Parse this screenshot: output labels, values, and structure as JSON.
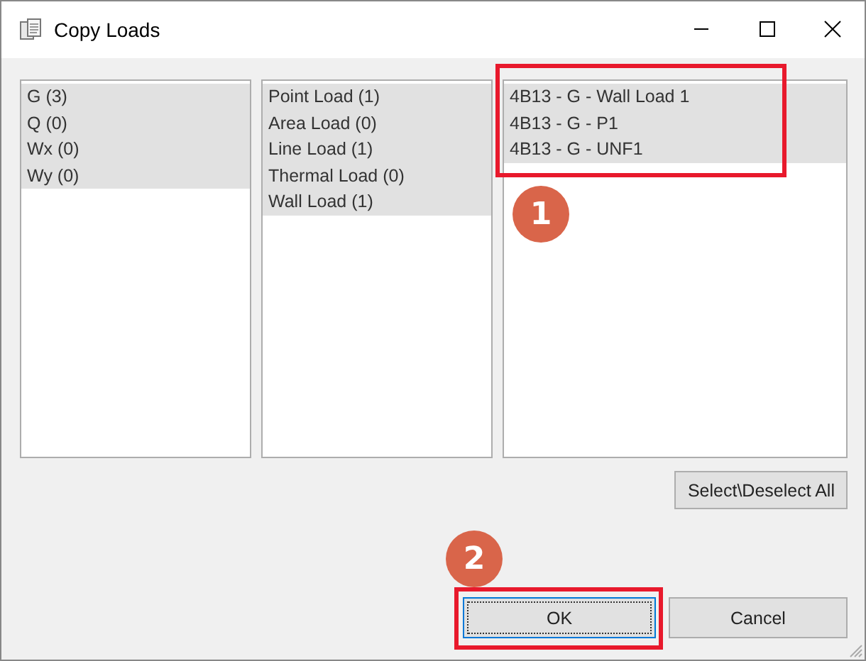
{
  "window": {
    "title": "Copy Loads"
  },
  "lists": [
    {
      "items": [
        {
          "label": "G (3)",
          "selected": true
        },
        {
          "label": "Q (0)",
          "selected": true
        },
        {
          "label": "Wx (0)",
          "selected": true
        },
        {
          "label": "Wy (0)",
          "selected": true
        }
      ]
    },
    {
      "items": [
        {
          "label": "Point Load (1)",
          "selected": true
        },
        {
          "label": "Area Load (0)",
          "selected": true
        },
        {
          "label": "Line Load (1)",
          "selected": true
        },
        {
          "label": "Thermal Load (0)",
          "selected": true
        },
        {
          "label": "Wall Load (1)",
          "selected": true
        }
      ]
    },
    {
      "items": [
        {
          "label": "4B13 - G - Wall Load 1",
          "selected": true
        },
        {
          "label": "4B13 - G - P1",
          "selected": true
        },
        {
          "label": "4B13 - G - UNF1",
          "selected": true
        }
      ]
    }
  ],
  "select_all_button": "Select\\Deselect All",
  "buttons": [
    {
      "label": "OK",
      "focused": true
    },
    {
      "label": "Cancel",
      "focused": false
    }
  ],
  "callouts": [
    {
      "label": "1"
    },
    {
      "label": "2"
    }
  ]
}
